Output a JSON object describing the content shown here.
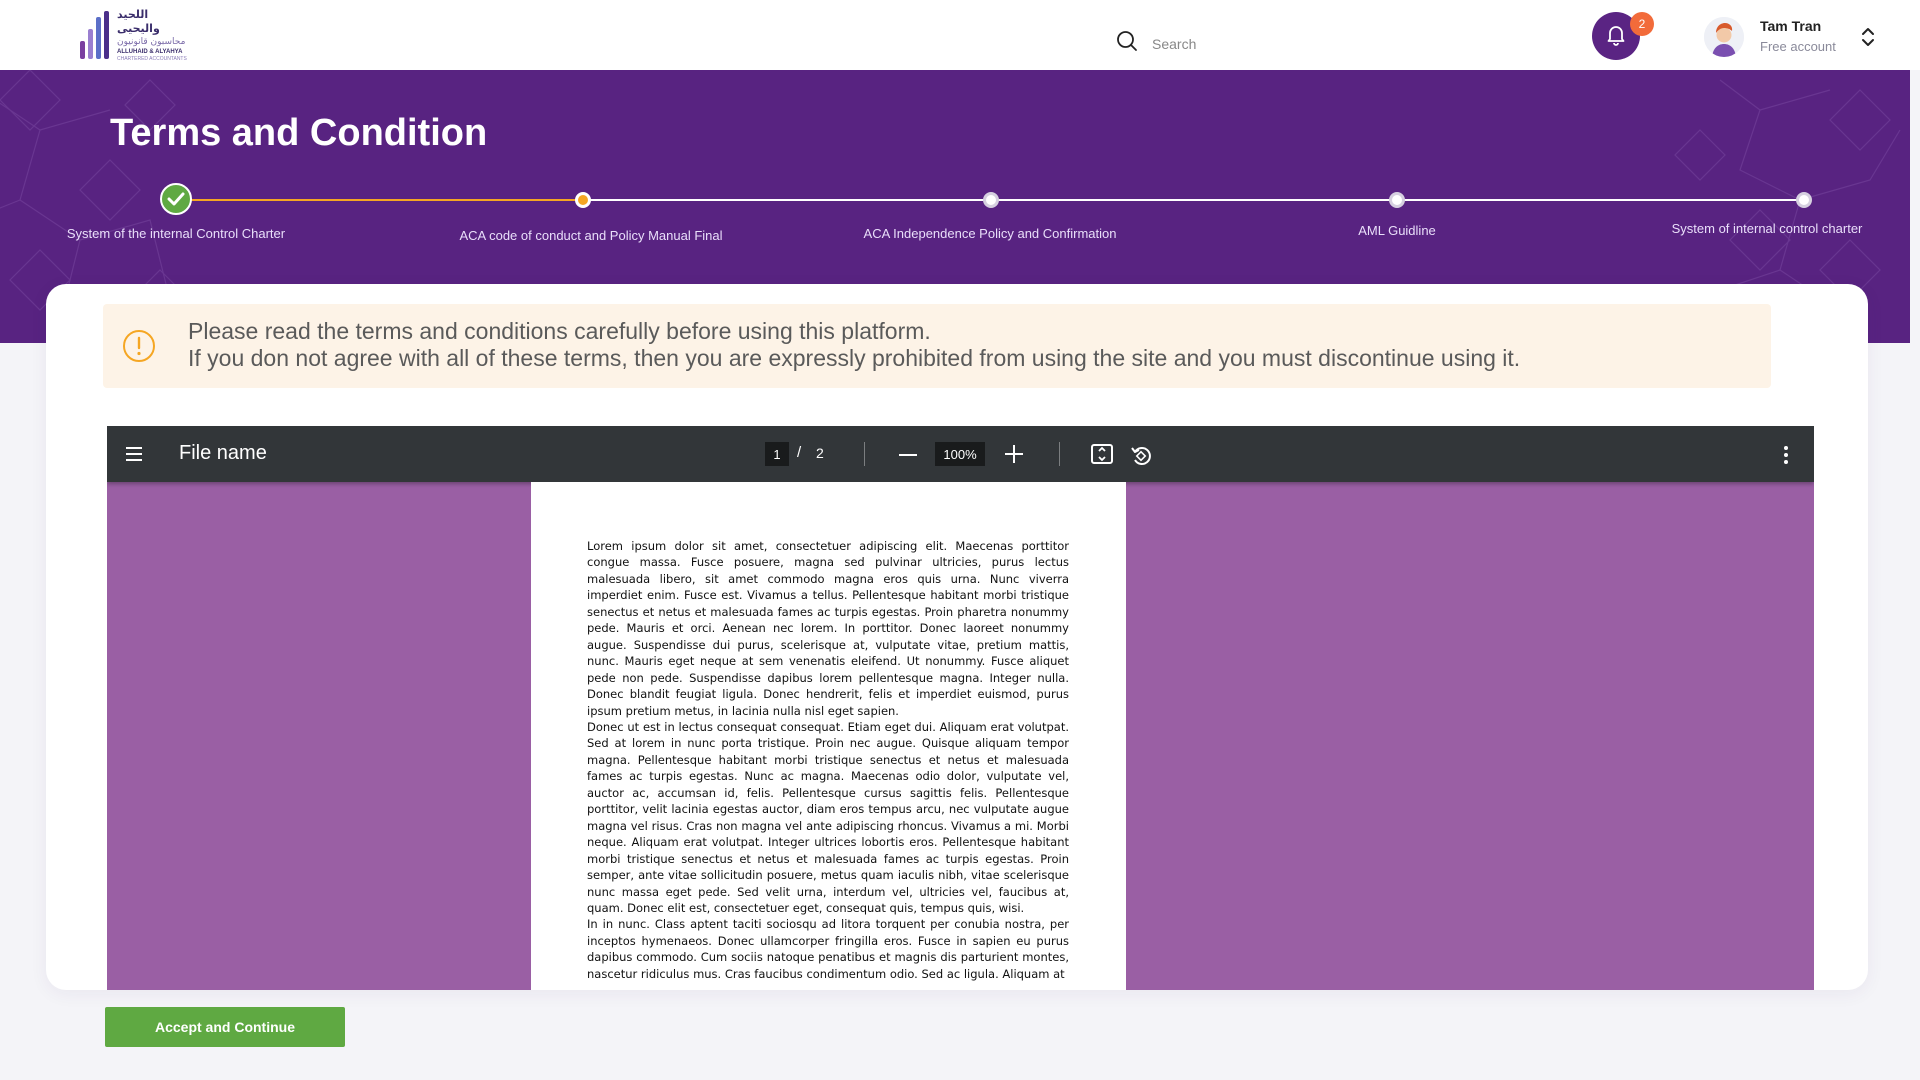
{
  "logo": {
    "arabic_name": "اللحيد واليحيى",
    "arabic_subtitle": "محاسبون قانونيون",
    "english_name": "ALLUHAID & ALYAHYA",
    "english_subtitle": "CHARTERED ACCOUNTANTS"
  },
  "header": {
    "search_placeholder": "Search",
    "notification_count": "2",
    "user_name": "Tam Tran",
    "user_plan": "Free account"
  },
  "page": {
    "title": "Terms and Condition"
  },
  "stepper": {
    "active_index": 1,
    "steps": [
      {
        "label": "System of the internal Control Charter",
        "status": "completed"
      },
      {
        "label": "ACA code of conduct and Policy Manual Final",
        "status": "current"
      },
      {
        "label": "ACA Independence Policy and Confirmation",
        "status": "pending"
      },
      {
        "label": "AML Guidline",
        "status": "pending"
      },
      {
        "label": "System of internal control charter",
        "status": "pending"
      }
    ]
  },
  "notice": {
    "line1": "Please read the terms and conditions carefully before  using this platform.",
    "line2": "If you don not agree with all of these terms, then you are expressly prohibited  from using the site  and you must discontinue using it."
  },
  "viewer": {
    "file_name": "File name",
    "current_page": "1",
    "separator": "/",
    "total_pages": "2",
    "zoom": "100%",
    "paragraphs": [
      "Lorem ipsum dolor sit amet, consectetuer adipiscing elit. Maecenas porttitor congue massa. Fusce posuere, magna sed pulvinar ultricies, purus lectus malesuada libero, sit amet commodo magna eros quis urna. Nunc viverra imperdiet enim. Fusce est. Vivamus a tellus. Pellentesque habitant morbi tristique senectus et netus et malesuada fames ac turpis egestas. Proin pharetra nonummy pede. Mauris et orci. Aenean nec lorem. In porttitor. Donec laoreet nonummy augue. Suspendisse dui purus, scelerisque at, vulputate vitae, pretium mattis, nunc. Mauris eget neque at sem venenatis eleifend. Ut nonummy. Fusce aliquet pede non pede. Suspendisse dapibus lorem pellentesque magna. Integer nulla. Donec blandit feugiat ligula. Donec hendrerit, felis et imperdiet euismod, purus ipsum pretium metus, in lacinia nulla nisl eget sapien.",
      "Donec ut est in lectus consequat consequat. Etiam eget dui. Aliquam erat volutpat. Sed at lorem in nunc porta tristique. Proin nec augue. Quisque aliquam tempor magna. Pellentesque habitant morbi tristique senectus et netus et malesuada fames ac turpis egestas. Nunc ac magna. Maecenas odio dolor, vulputate vel, auctor ac, accumsan id, felis. Pellentesque cursus sagittis felis. Pellentesque porttitor, velit lacinia egestas auctor, diam eros tempus arcu, nec vulputate augue magna vel risus. Cras non magna vel ante adipiscing rhoncus. Vivamus a mi. Morbi neque. Aliquam erat volutpat. Integer ultrices lobortis eros. Pellentesque habitant morbi tristique senectus et netus et malesuada fames ac turpis egestas. Proin semper, ante vitae sollicitudin posuere, metus quam iaculis nibh, vitae scelerisque nunc massa eget pede. Sed velit urna, interdum vel, ultricies vel, faucibus at, quam. Donec elit est, consectetuer eget, consequat quis, tempus quis, wisi.",
      "In in nunc. Class aptent taciti sociosqu ad litora torquent per conubia nostra, per inceptos hymenaeos. Donec ullamcorper fringilla eros. Fusce in sapien eu purus dapibus commodo. Cum sociis natoque penatibus et magnis dis parturient montes, nascetur ridiculus mus. Cras faucibus condimentum odio. Sed ac ligula. Aliquam at"
    ]
  },
  "actions": {
    "accept_label": "Accept and Continue"
  },
  "colors": {
    "brand_purple": "#582381",
    "viewer_background": "#9a5fa4",
    "progress_orange": "#f5a623",
    "success_green": "#5fa942",
    "notice_background": "#fdf3e7",
    "badge_orange": "#f26b3a"
  }
}
